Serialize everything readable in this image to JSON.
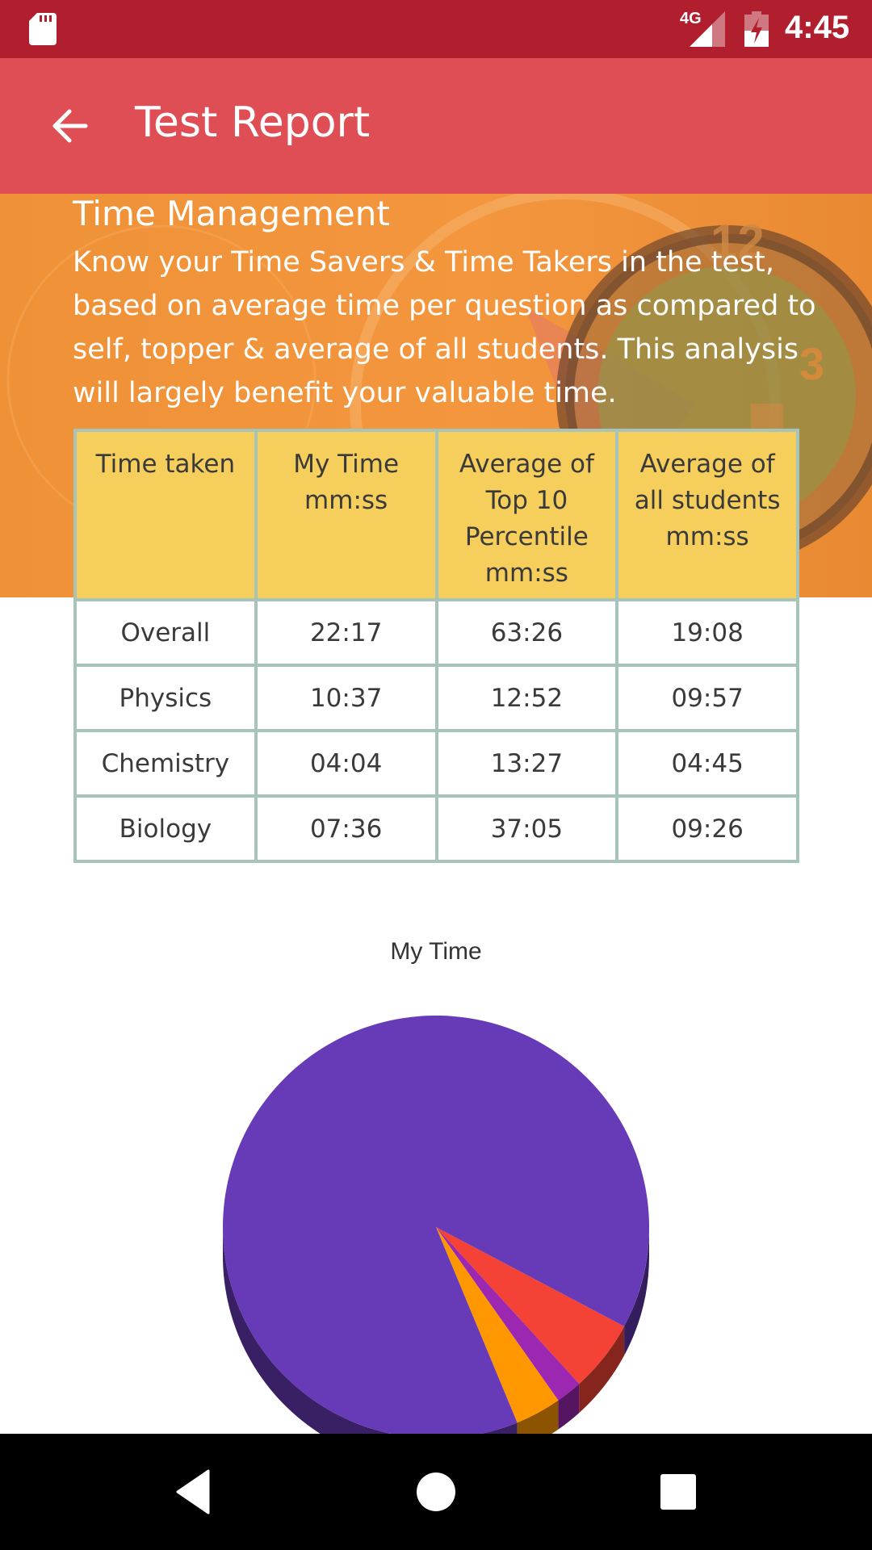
{
  "status_bar": {
    "network_label": "4G",
    "time": "4:45",
    "icons": [
      "sd-card-icon",
      "signal-icon",
      "battery-charging-icon"
    ]
  },
  "app_bar": {
    "title": "Test Report",
    "back_icon": "arrow-left-icon"
  },
  "section": {
    "title": "Time Management",
    "description": "Know your Time Savers & Time Takers in the test, based on average time per question as compared to self, topper & average of all students. This analysis will largely benefit your valuable time."
  },
  "table": {
    "headers": [
      "Time taken",
      "My Time mm:ss",
      "Average of Top 10 Percentile mm:ss",
      "Average of all students mm:ss"
    ],
    "rows": [
      [
        "Overall",
        "22:17",
        "63:26",
        "19:08"
      ],
      [
        "Physics",
        "10:37",
        "12:52",
        "09:57"
      ],
      [
        "Chemistry",
        "04:04",
        "13:27",
        "04:45"
      ],
      [
        "Biology",
        "07:36",
        "37:05",
        "09:26"
      ]
    ]
  },
  "colors": {
    "status_bar": "#B11E2E",
    "app_bar": "#E04E55",
    "banner": "#F0923A",
    "table_header": "#F6CE5C",
    "table_border": "#A7C4BB"
  },
  "chart_data": {
    "type": "pie",
    "title": "My Time",
    "style": "3d",
    "legend": "none",
    "categories": [
      "Slice 1",
      "Slice 2",
      "Slice 3",
      "Slice 4"
    ],
    "values": [
      89,
      5.5,
      2,
      3.5
    ],
    "colors": [
      "#673AB7",
      "#F44336",
      "#9C27B0",
      "#FF9800"
    ]
  },
  "nav_bar": {
    "buttons": [
      "back",
      "home",
      "recents"
    ]
  }
}
